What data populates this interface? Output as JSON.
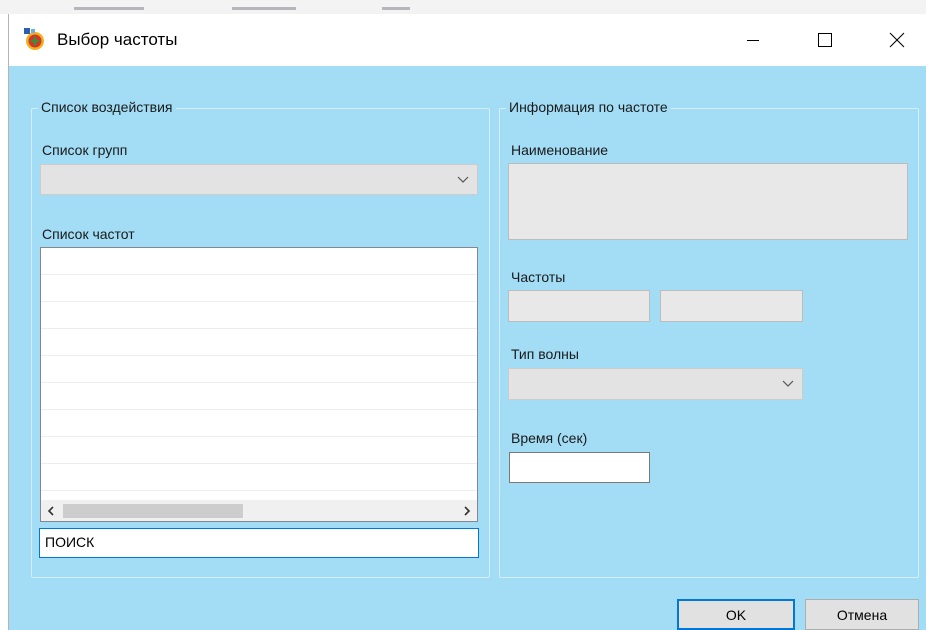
{
  "window": {
    "title": "Выбор частоты"
  },
  "left_group": {
    "title": "Список воздействия",
    "groups_label": "Список групп",
    "groups_value": "",
    "freq_label": "Список частот",
    "freq_rows": [
      "",
      "",
      "",
      "",
      "",
      "",
      "",
      "",
      ""
    ],
    "search_value": "ПОИСК"
  },
  "right_group": {
    "title": "Информация по частоте",
    "name_label": "Наименование",
    "name_value": "",
    "freq_label": "Частоты",
    "freq1_value": "",
    "freq2_value": "",
    "wave_label": "Тип волны",
    "wave_value": "",
    "time_label": "Время (сек)",
    "time_value": ""
  },
  "buttons": {
    "ok": "OK",
    "cancel": "Отмена"
  },
  "colors": {
    "client_bg": "#a2dcf5",
    "focus_border": "#0078d7"
  },
  "icons": {
    "app": "app-logo-icon",
    "minimize": "minimize-icon",
    "maximize": "maximize-icon",
    "close": "close-icon"
  }
}
